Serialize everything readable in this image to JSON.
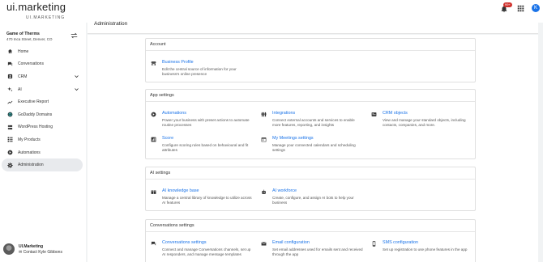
{
  "brand": {
    "logo": "ui.marketing",
    "sub": "UI.MARKETING"
  },
  "topbar": {
    "notification_count": "99+",
    "avatar_letter": "K"
  },
  "business": {
    "name": "Game of Therms",
    "address": "470 Inca Street, Denver, CO"
  },
  "sidebar": {
    "items": [
      {
        "label": "Home",
        "icon": "home-icon"
      },
      {
        "label": "Conversations",
        "icon": "chat-icon"
      },
      {
        "label": "CRM",
        "icon": "crm-icon",
        "has_chevron": true
      },
      {
        "label": "AI",
        "icon": "ai-sparkle-icon",
        "has_chevron": true
      },
      {
        "label": "Executive Report",
        "icon": "trend-icon"
      },
      {
        "label": "GoDaddy Domains",
        "icon": "globe-icon"
      },
      {
        "label": "WordPress Hosting",
        "icon": "server-icon"
      },
      {
        "label": "My Products",
        "icon": "products-grid-icon"
      },
      {
        "label": "Automations",
        "icon": "automation-icon"
      },
      {
        "label": "Administration",
        "icon": "gear-icon",
        "active": true
      }
    ]
  },
  "profile": {
    "name": "UI.Marketing",
    "contact": "Contact Kyle Gibbons"
  },
  "page": {
    "title": "Administration"
  },
  "sections": {
    "account": {
      "heading": "Account",
      "tiles": [
        {
          "title": "Business Profile",
          "desc": "Edit the central source of information for your business's online presence",
          "icon": "storefront-icon"
        }
      ]
    },
    "app": {
      "heading": "App settings",
      "tiles": [
        {
          "title": "Automations",
          "desc": "Power your business with preset actions to automate routine processes",
          "icon": "automation-icon"
        },
        {
          "title": "Integrations",
          "desc": "Connect external accounts and services to enable more features, reporting, and insights",
          "icon": "integrations-icon"
        },
        {
          "title": "CRM objects",
          "desc": "View and manage your standard objects, including contacts, companies, and more.",
          "icon": "crm-objects-icon"
        },
        {
          "title": "Score",
          "desc": "Configure scoring rules based on behavioural and fit attributes",
          "icon": "score-icon"
        },
        {
          "title": "My Meetings settings",
          "desc": "Manage your connected calendars and scheduling settings",
          "icon": "calendar-icon"
        }
      ]
    },
    "ai": {
      "heading": "AI settings",
      "tiles": [
        {
          "title": "AI knowledge base",
          "desc": "Manage a central library of knowledge to utilize across AI features",
          "icon": "book-icon"
        },
        {
          "title": "AI workforce",
          "desc": "Create, configure, and assign AI bots to help your business",
          "icon": "robot-icon"
        }
      ]
    },
    "conversations": {
      "heading": "Conversations settings",
      "tiles": [
        {
          "title": "Conversations settings",
          "desc": "Connect and manage Conversations channels, set up AI responders, and manage message templates",
          "icon": "chat-icon"
        },
        {
          "title": "Email configuration",
          "desc": "Set email addresses used for emails sent and received through the app",
          "icon": "mail-icon"
        },
        {
          "title": "SMS configuration",
          "desc": "Set up registration to use phone features in the app",
          "icon": "phone-icon"
        }
      ]
    }
  }
}
